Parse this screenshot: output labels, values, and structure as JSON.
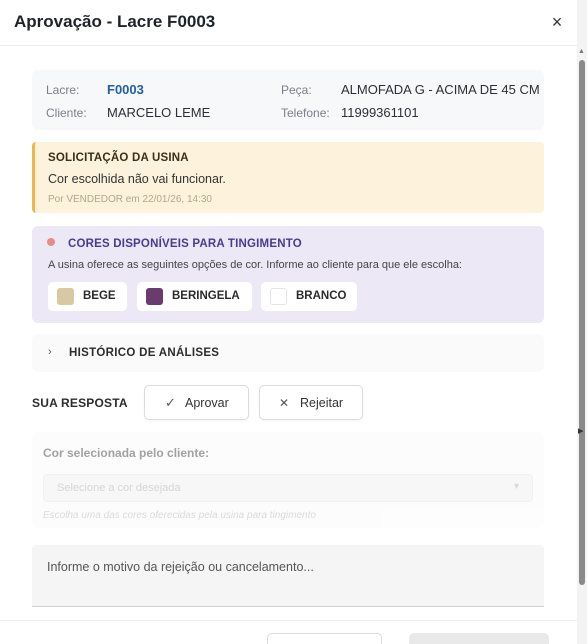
{
  "modal": {
    "title": "Aprovação - Lacre F0003",
    "close_glyph": "×"
  },
  "info": {
    "lacre_label": "Lacre:",
    "lacre_value": "F0003",
    "cliente_label": "Cliente:",
    "cliente_value": "MARCELO LEME",
    "peca_label": "Peça:",
    "peca_value": "ALMOFADA G - ACIMA DE 45 CM",
    "telefone_label": "Telefone:",
    "telefone_value": "11999361101"
  },
  "alert": {
    "title": "SOLICITAÇÃO DA USINA",
    "text": "Cor escolhida não vai funcionar.",
    "meta": "Por VENDEDOR em 22/01/26, 14:30",
    "accent": "#f0b64a"
  },
  "colors": {
    "title": "CORES DISPONÍVEIS PARA TINGIMENTO",
    "text": "A usina oferece as seguintes opções de cor. Informe ao cliente para que ele escolha:",
    "options": [
      {
        "label": "BEGE",
        "hex": "#d8c9a3"
      },
      {
        "label": "BERINGELA",
        "hex": "#6b3a6e"
      },
      {
        "label": "BRANCO",
        "hex": "#ffffff"
      }
    ]
  },
  "history": {
    "label": "HISTÓRICO DE ANÁLISES",
    "chevron": "›"
  },
  "response": {
    "label": "SUA RESPOSTA",
    "approve_label": "Aprovar",
    "approve_icon": "✓",
    "reject_label": "Rejeitar",
    "reject_icon": "✕"
  },
  "selection": {
    "label": "Cor selecionada pelo cliente:",
    "value": "Selecione a cor desejada",
    "help": "Escolha uma das cores oferecidas pela usina para tingimento"
  },
  "reason": {
    "placeholder": "Informe o motivo da rejeição ou cancelamento..."
  }
}
